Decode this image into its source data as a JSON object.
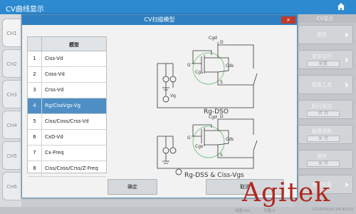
{
  "app": {
    "title": "CV曲线显示"
  },
  "channels": [
    "CH1",
    "CH2",
    "CH3",
    "CH4",
    "CH5",
    "CH6"
  ],
  "right_menu": {
    "header": "CV显示",
    "buttons": [
      {
        "label": "模型",
        "sub": ""
      },
      {
        "label": "提体显示",
        "sub": "配置"
      },
      {
        "label": "图表工具",
        "sub": ""
      },
      {
        "label": "标尺自动",
        "sub": "开 开"
      },
      {
        "label": "触摸读数",
        "sub": "关 开"
      },
      {
        "label": "保存",
        "sub": "关 开"
      },
      {
        "label": "保存配置",
        "sub": ""
      }
    ]
  },
  "dialog": {
    "title": "CV扫描模型",
    "close_label": "×",
    "table_header": "模型",
    "rows": [
      {
        "num": "1",
        "name": "Ciss-Vd"
      },
      {
        "num": "2",
        "name": "Coss-Vd"
      },
      {
        "num": "3",
        "name": "Crss-Vd"
      },
      {
        "num": "4",
        "name": "Rg/CissVgs-Vg"
      },
      {
        "num": "5",
        "name": "Ciss/Coss/Crss-Vd"
      },
      {
        "num": "6",
        "name": "CxD-Vd"
      },
      {
        "num": "7",
        "name": "Cx-Freq"
      },
      {
        "num": "8",
        "name": "Ciss/Coss/Crss/Z-Freq"
      }
    ],
    "selected_row": 4,
    "circuit1_label": "Rg-DSO",
    "circuit2_label": "Rg-DSS & Ciss-Vgs",
    "component_labels": {
      "cgd": "Cgd",
      "cds": "Cds",
      "cgs": "Cgs",
      "d": "D",
      "g": "G",
      "s": "S",
      "vg": "Vg"
    },
    "ok_label": "确定",
    "cancel_label": "取消"
  },
  "status": {
    "seg1": "线路 0m",
    "seg2": "开路 0",
    "seg3": "2024/05/20 09:40:52"
  },
  "watermark": "Agitek",
  "colors": {
    "title_bar": "#2d8ad0",
    "dialog_title": "#2e7fc1",
    "selected_row": "#4f8fc5",
    "close": "#c0392b",
    "watermark": "#b0281f",
    "cap_circle": "#6fbf7a"
  }
}
